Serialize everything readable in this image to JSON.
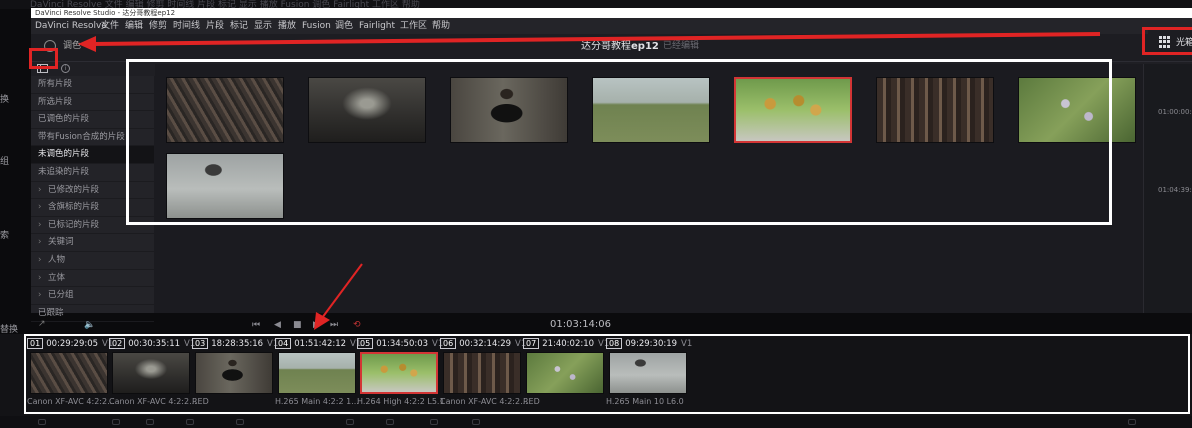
{
  "ghost_top": "DaVinci Resolve   文件   编辑   修剪   时间线   片段   标记   显示   播放   Fusion   调色   Fairlight   工作区   帮助",
  "window_title": "DaVinci Resolve Studio - 达分哥教程ep12",
  "menu": {
    "items": [
      "DaVinci Resolve",
      "文件",
      "编辑",
      "修剪",
      "时间线",
      "片段",
      "标记",
      "显示",
      "播放",
      "Fusion",
      "调色",
      "Fairlight",
      "工作区",
      "帮助"
    ]
  },
  "header": {
    "left_label": "调色",
    "project": "达分哥教程",
    "project_bold": "ep12",
    "status": "已经编辑",
    "right_label": "光箱"
  },
  "edge_chars": [
    "换",
    "组",
    "索",
    "替换"
  ],
  "sidebar": {
    "items": [
      {
        "label": "所有片段",
        "chevron": false,
        "selected": false
      },
      {
        "label": "所选片段",
        "chevron": false,
        "selected": false
      },
      {
        "label": "已调色的片段",
        "chevron": false,
        "selected": false
      },
      {
        "label": "带有Fusion合成的片段",
        "chevron": false,
        "selected": false
      },
      {
        "label": "未调色的片段",
        "chevron": false,
        "selected": true
      },
      {
        "label": "未追染的片段",
        "chevron": false,
        "selected": false
      },
      {
        "label": "已修改的片段",
        "chevron": true,
        "selected": false
      },
      {
        "label": "含旗标的片段",
        "chevron": true,
        "selected": false
      },
      {
        "label": "已标记的片段",
        "chevron": true,
        "selected": false
      },
      {
        "label": "关键词",
        "chevron": true,
        "selected": false
      },
      {
        "label": "人物",
        "chevron": true,
        "selected": false
      },
      {
        "label": "立体",
        "chevron": true,
        "selected": false
      },
      {
        "label": "已分组",
        "chevron": true,
        "selected": false
      },
      {
        "label": "已跟踪",
        "chevron": false,
        "selected": false
      }
    ]
  },
  "right_panel": {
    "timecodes": [
      "01:00:00:0",
      "01:04:39:2"
    ]
  },
  "viewer": {
    "timecode": "01:03:14:06",
    "prev_glyph": "⏮",
    "rew_glyph": "◀",
    "stop_glyph": "■",
    "play_glyph": "▶",
    "next_glyph": "⏭",
    "loop_glyph": "⟲",
    "volume_glyph": "🔈",
    "tool_glyph": "↗"
  },
  "colors": {
    "highlight_red": "#e02424",
    "selection_red": "#d33535",
    "highlight_white": "#ffffff"
  },
  "timeline_clips": [
    {
      "num": "01",
      "tc": "00:29:29:05",
      "track": "V1",
      "codec": "Canon XF-AVC 4:2:2...",
      "scene": "factory-roof",
      "selected": false
    },
    {
      "num": "02",
      "tc": "00:30:35:11",
      "track": "V1",
      "codec": "Canon XF-AVC 4:2:2...",
      "scene": "factory-interior",
      "selected": false
    },
    {
      "num": "03",
      "tc": "18:28:35:16",
      "track": "V1",
      "codec": "RED",
      "scene": "man-camera",
      "selected": false
    },
    {
      "num": "04",
      "tc": "01:51:42:12",
      "track": "V1",
      "codec": "H.265 Main 4:2:2 1...",
      "scene": "horses-field",
      "selected": false
    },
    {
      "num": "05",
      "tc": "01:34:50:03",
      "track": "V1",
      "codec": "H.264 High 4:2:2 L5.1",
      "scene": "flower-bench",
      "selected": true
    },
    {
      "num": "06",
      "tc": "00:32:14:29",
      "track": "V1",
      "codec": "Canon XF-AVC 4:2:2...",
      "scene": "workshop",
      "selected": false
    },
    {
      "num": "07",
      "tc": "21:40:02:10",
      "track": "V1",
      "codec": "RED",
      "scene": "lavender",
      "selected": false
    },
    {
      "num": "08",
      "tc": "09:29:30:19",
      "track": "V1",
      "codec": "H.265 Main 10 L6.0",
      "scene": "horse-table",
      "selected": false
    }
  ]
}
